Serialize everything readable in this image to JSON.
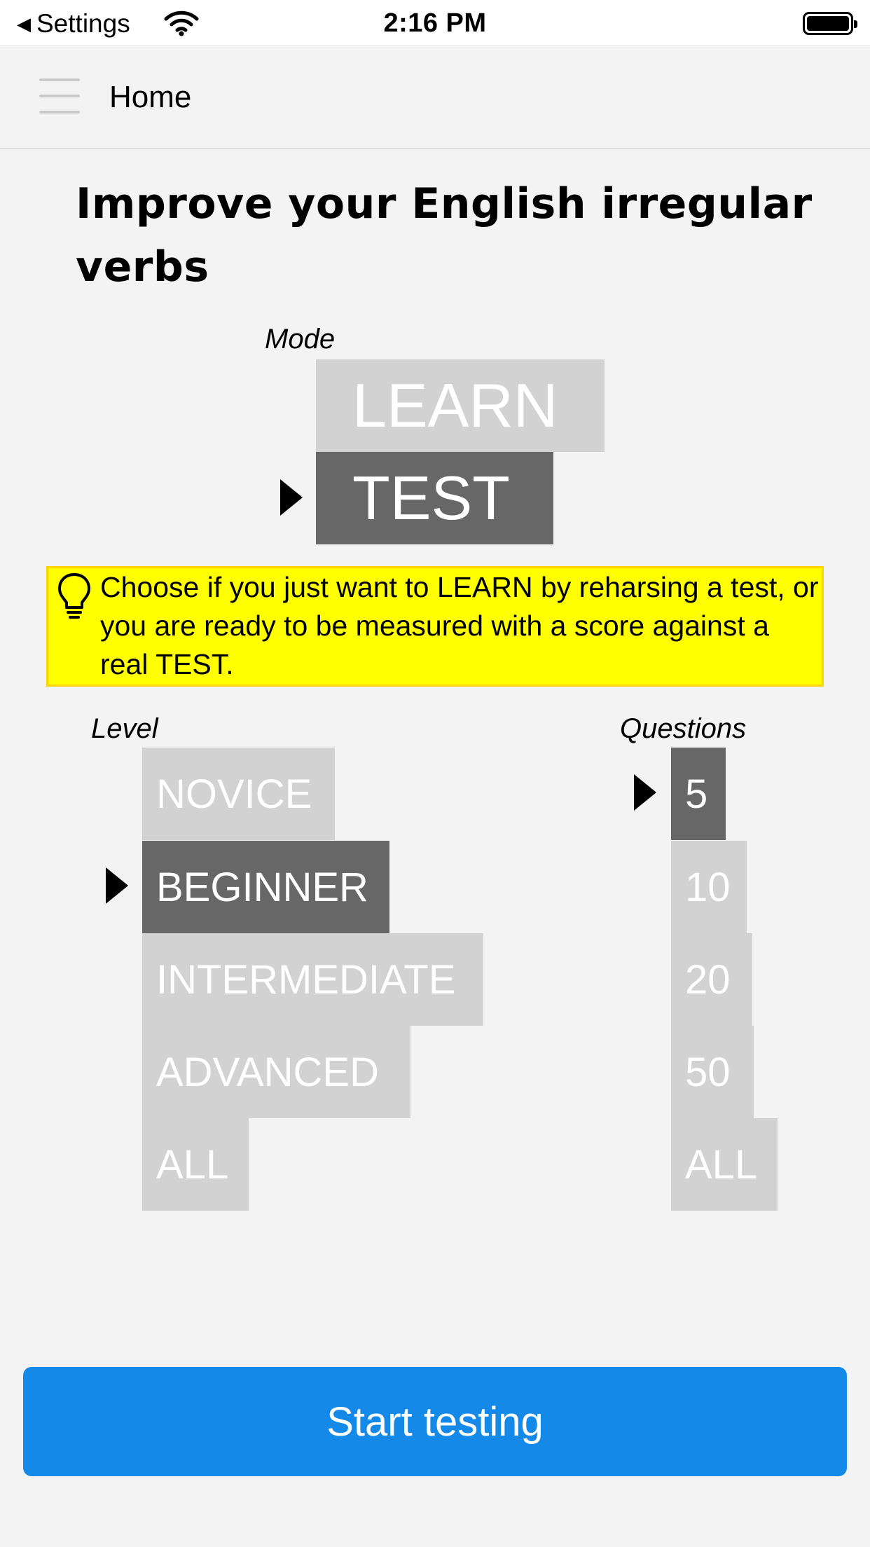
{
  "status_bar": {
    "back_label": "Settings",
    "time": "2:16 PM",
    "icons": [
      "back-triangle-icon",
      "wifi-icon",
      "battery-icon"
    ]
  },
  "header": {
    "title": "Home",
    "menu_icon": "hamburger-menu-icon"
  },
  "main": {
    "title": "Improve your English irregular verbs"
  },
  "mode": {
    "label": "Mode",
    "options": [
      "LEARN",
      "TEST"
    ],
    "selected": "TEST"
  },
  "hint": {
    "icon": "lightbulb-icon",
    "text": "Choose if you just want to LEARN by reharsing a test, or you are ready to be measured with a score against a real TEST."
  },
  "level": {
    "label": "Level",
    "options": [
      "NOVICE",
      "BEGINNER",
      "INTERMEDIATE",
      "ADVANCED",
      "ALL"
    ],
    "selected": "BEGINNER"
  },
  "questions": {
    "label": "Questions",
    "options": [
      "5",
      "10",
      "20",
      "50",
      "ALL"
    ],
    "selected": "5"
  },
  "footer": {
    "start_label": "Start testing"
  },
  "colors": {
    "background": "#f3f3f3",
    "option_unselected": "#d2d2d2",
    "option_selected": "#676767",
    "hint_background": "#ffff00",
    "primary_button": "#1589e8"
  }
}
